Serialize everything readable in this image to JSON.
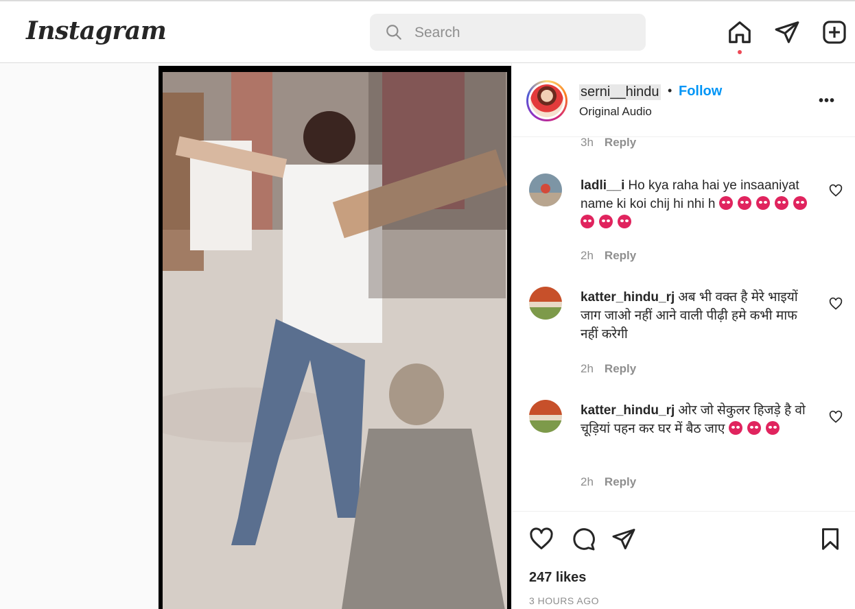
{
  "app": {
    "logo": "Instagram"
  },
  "search": {
    "placeholder": "Search"
  },
  "nav": {
    "icons": [
      "home-icon",
      "paper-plane-icon",
      "plus-square-icon"
    ]
  },
  "post": {
    "username": "serni__hindu",
    "separator": "•",
    "follow_label": "Follow",
    "subtitle": "Original Audio",
    "more_label": "•••",
    "likes": "247 likes",
    "timestamp": "3 HOURS AGO"
  },
  "comments": [
    {
      "meta_time": "3h",
      "reply_label": "Reply",
      "partial": true
    },
    {
      "username": "ladli__i",
      "text": "Ho kya raha hai ye insaaniyat name ki koi chij hi nhi h",
      "emoji_count": 8,
      "emoji": "angry-face-emoji",
      "time": "2h",
      "reply_label": "Reply"
    },
    {
      "username": "katter_hindu_rj",
      "text": "अब भी वक्त है मेरे भाइयों जाग जाओ नहीं आने वाली पीढ़ी हमे कभी माफ नहीं करेगी",
      "emoji_count": 0,
      "time": "2h",
      "reply_label": "Reply"
    },
    {
      "username": "katter_hindu_rj",
      "text": "ओर जो सेकुलर हिजड़े है वो चूड़ियां पहन कर घर में बैठ जाए",
      "emoji_count": 3,
      "emoji": "angry-face-emoji",
      "time": "2h",
      "reply_label": "Reply"
    }
  ],
  "colors": {
    "accent": "#0095f6",
    "text": "#262626",
    "muted": "#8e8e8e",
    "notification": "#ed4956"
  }
}
